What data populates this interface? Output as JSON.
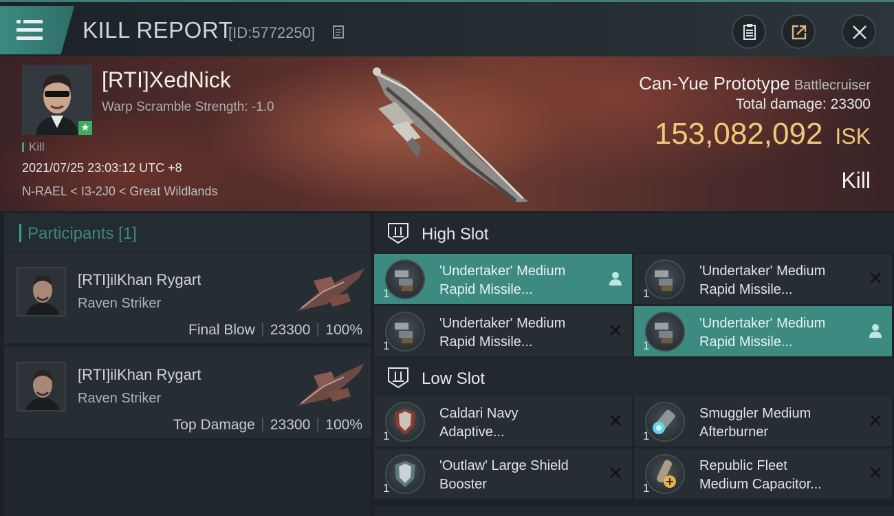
{
  "header": {
    "title": "KILL REPORT",
    "id_text": "[ID:5772250]",
    "icons": [
      "menu-icon",
      "copy-icon",
      "clipboard-icon",
      "share-icon",
      "close-icon"
    ]
  },
  "victim": {
    "name": "[RTI]XedNick",
    "warp_scramble": "Warp Scramble Strength: -1.0",
    "tag": "Kill",
    "datetime": "2021/07/25 23:03:12 UTC +8",
    "location": "N-RAEL < I3-2J0 < Great Wildlands",
    "ship_name": "Can-Yue Prototype",
    "ship_class": "Battlecruiser",
    "total_damage_label": "Total damage:",
    "total_damage": "23300",
    "isk_value": "153,082,092",
    "isk_unit": "ISK",
    "result": "Kill"
  },
  "participants": {
    "title": "Participants",
    "count": "[1]",
    "rows": [
      {
        "name": "[RTI]ilKhan Rygart",
        "ship": "Raven Striker",
        "role": "Final Blow",
        "damage": "23300",
        "percent": "100%"
      },
      {
        "name": "[RTI]ilKhan Rygart",
        "ship": "Raven Striker",
        "role": "Top Damage",
        "damage": "23300",
        "percent": "100%"
      }
    ]
  },
  "fitting": {
    "high_slot": {
      "label": "High Slot",
      "modules": [
        {
          "line1": "'Undertaker' Medium",
          "line2": "Rapid Missile...",
          "qty": "1",
          "status": "person-icon",
          "active": true
        },
        {
          "line1": "'Undertaker' Medium",
          "line2": "Rapid Missile...",
          "qty": "1",
          "status": "cross-icon",
          "active": false
        },
        {
          "line1": "'Undertaker' Medium",
          "line2": "Rapid Missile...",
          "qty": "1",
          "status": "cross-icon",
          "active": false
        },
        {
          "line1": "'Undertaker' Medium",
          "line2": "Rapid Missile...",
          "qty": "1",
          "status": "person-icon",
          "active": true
        }
      ]
    },
    "low_slot": {
      "label": "Low Slot",
      "modules": [
        {
          "line1": "Caldari Navy",
          "line2": "Adaptive...",
          "qty": "1",
          "status": "cross-icon"
        },
        {
          "line1": "Smuggler Medium",
          "line2": "Afterburner",
          "qty": "1",
          "status": "cross-icon"
        },
        {
          "line1": "'Outlaw' Large Shield",
          "line2": "Booster",
          "qty": "1",
          "status": "cross-icon"
        },
        {
          "line1": "Republic Fleet",
          "line2": "Medium Capacitor...",
          "qty": "1",
          "status": "cross-icon"
        }
      ]
    }
  },
  "colors": {
    "accent": "#3c8a80",
    "isk": "#f0c877",
    "panel": "#262e33"
  }
}
